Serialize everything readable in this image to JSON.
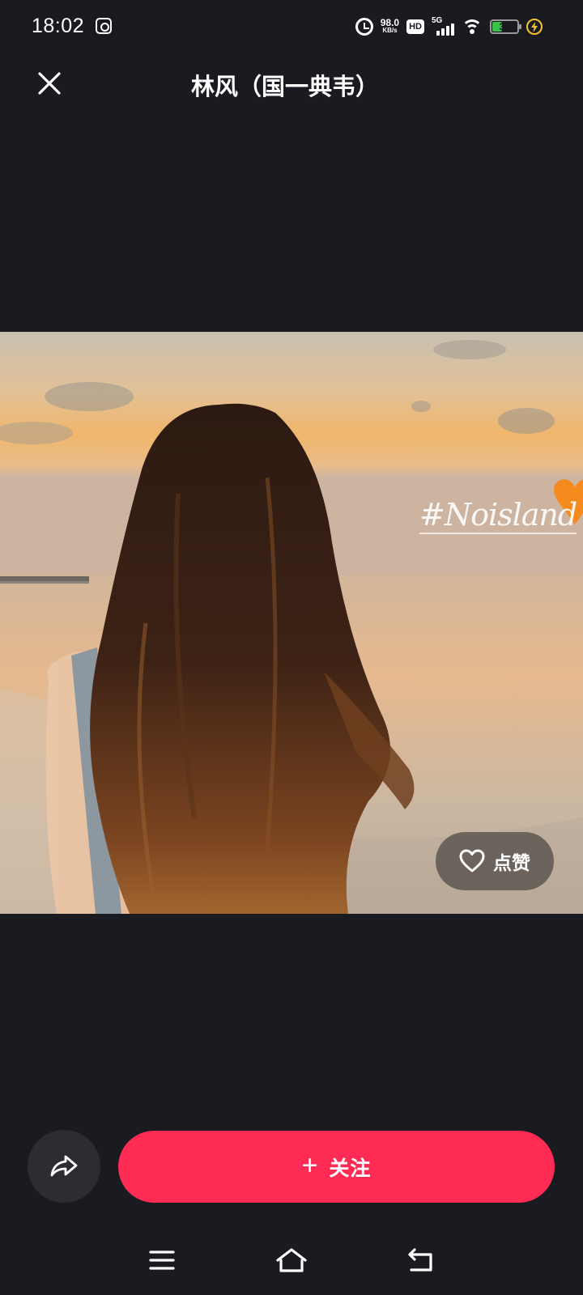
{
  "status_bar": {
    "time": "18:02",
    "network_speed_value": "98.0",
    "network_speed_unit": "KB/s",
    "hd_badge": "HD",
    "network_gen": "5G",
    "battery_percent": "33",
    "battery_level": 0.33,
    "icons": [
      "app-notification-icon",
      "alarm-icon",
      "hd-icon",
      "cellular-signal-icon",
      "wifi-icon",
      "battery-icon",
      "charging-icon"
    ]
  },
  "header": {
    "title": "林风（国一典韦）",
    "close_icon": "close-icon"
  },
  "photo": {
    "watermark_text": "#Noisland",
    "watermark_emoji": "🧡",
    "like_label": "点赞",
    "like_icon": "heart-outline-icon"
  },
  "actions": {
    "share_icon": "share-arrow-icon",
    "follow_plus": "+",
    "follow_label": "关注",
    "follow_color": "#fe2c55"
  },
  "system_nav": {
    "icons": [
      "menu-icon",
      "home-icon",
      "back-icon"
    ]
  },
  "colors": {
    "background": "#1a1a21",
    "accent": "#fe2c55",
    "battery_fill": "#3bc24a"
  }
}
